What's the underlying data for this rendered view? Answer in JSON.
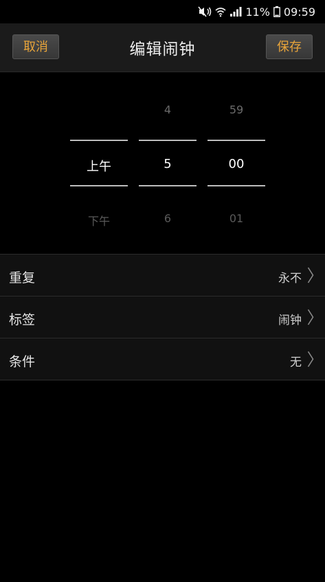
{
  "status_bar": {
    "battery_percent": "11%",
    "time": "09:59",
    "icons": [
      "mute-vibrate-icon",
      "wifi-icon",
      "signal-icon",
      "battery-icon"
    ]
  },
  "header": {
    "cancel_label": "取消",
    "title": "编辑闹钟",
    "save_label": "保存",
    "accent_color": "#e8a43a"
  },
  "picker": {
    "ampm": {
      "prev": "",
      "selected": "上午",
      "next": "下午"
    },
    "hour": {
      "prev": "4",
      "selected": "5",
      "next": "6"
    },
    "minute": {
      "prev": "59",
      "selected": "00",
      "next": "01"
    }
  },
  "settings": [
    {
      "label": "重复",
      "value": "永不"
    },
    {
      "label": "标签",
      "value": "闹钟"
    },
    {
      "label": "条件",
      "value": "无"
    }
  ]
}
